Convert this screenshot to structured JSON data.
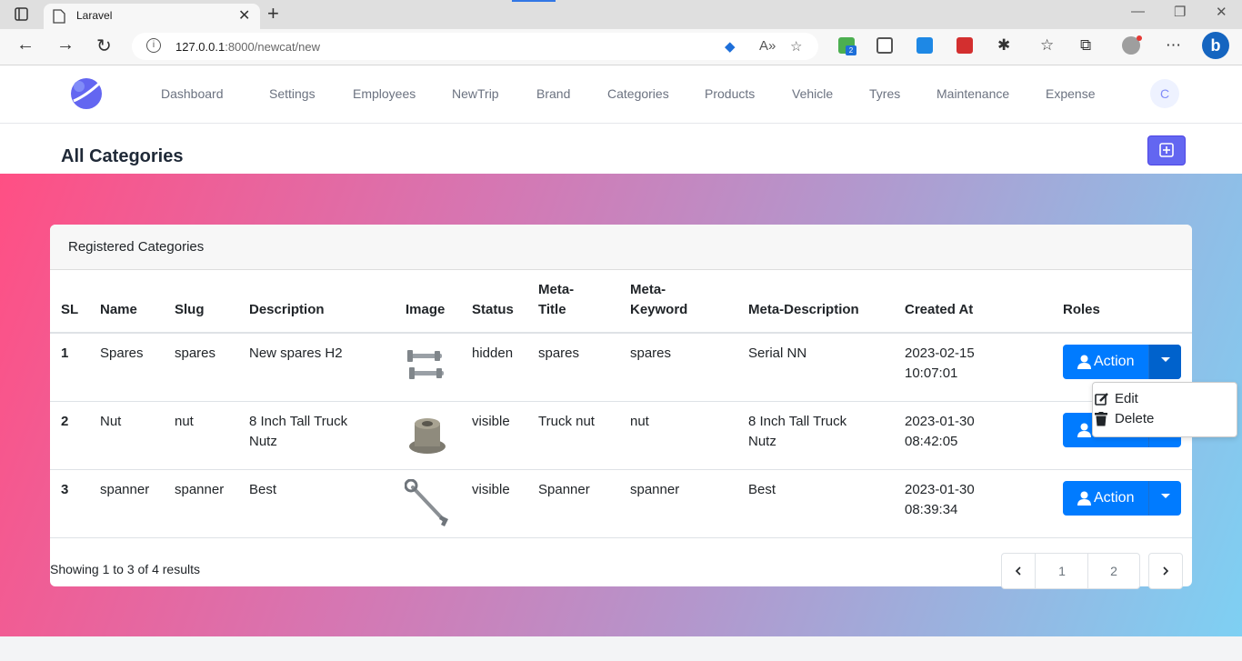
{
  "browser": {
    "tab_title": "Laravel",
    "url_host": "127.0.0.1",
    "url_rest": ":8000/newcat/new",
    "extension_badge": "2"
  },
  "nav": {
    "links": [
      "Dashboard",
      "Settings",
      "Employees",
      "NewTrip",
      "Brand",
      "Categories",
      "Products",
      "Vehicle",
      "Tyres",
      "Maintenance",
      "Expense"
    ],
    "user_initial": "C"
  },
  "page": {
    "title": "All Categories",
    "card_title": "Registered Categories"
  },
  "table": {
    "headers": {
      "sl": "SL",
      "name": "Name",
      "slug": "Slug",
      "description": "Description",
      "image": "Image",
      "status": "Status",
      "meta_title_1": "Meta-",
      "meta_title_2": "Title",
      "meta_keyword_1": "Meta-",
      "meta_keyword_2": "Keyword",
      "meta_description": "Meta-Description",
      "created_at": "Created At",
      "roles": "Roles"
    },
    "rows": [
      {
        "sl": "1",
        "name": "Spares",
        "slug": "spares",
        "description_1": "New spares H2",
        "description_2": "",
        "image": "bolts",
        "status": "hidden",
        "meta_title": "spares",
        "meta_keyword": "spares",
        "meta_description_1": "Serial NN",
        "meta_description_2": "",
        "created_1": "2023-02-15",
        "created_2": "10:07:01",
        "action": "Action"
      },
      {
        "sl": "2",
        "name": "Nut",
        "slug": "nut",
        "description_1": "8 Inch Tall Truck",
        "description_2": "Nutz",
        "image": "nut",
        "status": "visible",
        "meta_title": "Truck nut",
        "meta_keyword": "nut",
        "meta_description_1": "8 Inch Tall Truck",
        "meta_description_2": "Nutz",
        "created_1": "2023-01-30",
        "created_2": "08:42:05",
        "action": "Action"
      },
      {
        "sl": "3",
        "name": "spanner",
        "slug": "spanner",
        "description_1": "Best",
        "description_2": "",
        "image": "spanner",
        "status": "visible",
        "meta_title": "Spanner",
        "meta_keyword": "spanner",
        "meta_description_1": "Best",
        "meta_description_2": "",
        "created_1": "2023-01-30",
        "created_2": "08:39:34",
        "action": "Action"
      }
    ]
  },
  "dropdown": {
    "edit": "Edit",
    "delete": "Delete"
  },
  "footer": {
    "showing": "Showing 1 to 3 of 4 results",
    "pages": [
      "1",
      "2"
    ]
  },
  "colors": {
    "primary": "#007bff",
    "indigo": "#6366f1"
  }
}
